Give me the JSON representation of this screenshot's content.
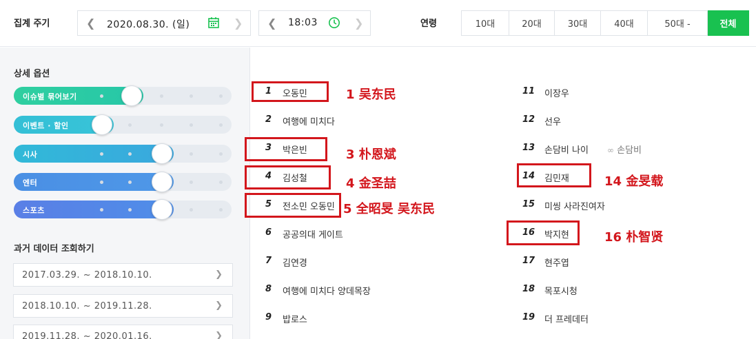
{
  "top": {
    "aggregation_label": "집계 주기",
    "date_value": "2020.08.30. (일)",
    "time_value": "18:03",
    "age_label": "연령",
    "age_options": [
      "10대",
      "20대",
      "30대",
      "40대",
      "50대 -",
      "전체"
    ],
    "age_selected": "전체"
  },
  "left": {
    "options_title": "상세 옵션",
    "toggles": [
      {
        "label": "이슈별 묶어보기",
        "on": true
      },
      {
        "label": "이벤트 · 할인",
        "on": false
      },
      {
        "label": "시사",
        "on": true
      },
      {
        "label": "엔터",
        "on": true
      },
      {
        "label": "스포츠",
        "on": true
      }
    ],
    "past_title": "과거 데이터 조회하기",
    "periods": [
      "2017.03.29. ~ 2018.10.10.",
      "2018.10.10. ~ 2019.11.28.",
      "2019.11.28. ~ 2020.01.16."
    ]
  },
  "ranking": {
    "left_col": [
      {
        "rank": "1",
        "term": "오동민"
      },
      {
        "rank": "2",
        "term": "여행에 미치다"
      },
      {
        "rank": "3",
        "term": "박은빈"
      },
      {
        "rank": "4",
        "term": "김성철"
      },
      {
        "rank": "5",
        "term": "전소민 오동민"
      },
      {
        "rank": "6",
        "term": "공공의대 게이트"
      },
      {
        "rank": "7",
        "term": "김연경"
      },
      {
        "rank": "8",
        "term": "여행에 미치다 양데목장"
      },
      {
        "rank": "9",
        "term": "밥로스"
      }
    ],
    "right_col": [
      {
        "rank": "11",
        "term": "이장우"
      },
      {
        "rank": "12",
        "term": "선우"
      },
      {
        "rank": "13",
        "term": "손담비 나이",
        "related": "손담비"
      },
      {
        "rank": "14",
        "term": "김민재"
      },
      {
        "rank": "15",
        "term": "미씽 사라진여자"
      },
      {
        "rank": "16",
        "term": "박지현"
      },
      {
        "rank": "17",
        "term": "현주엽"
      },
      {
        "rank": "18",
        "term": "목포시청"
      },
      {
        "rank": "19",
        "term": "더 프레데터"
      }
    ]
  },
  "annotations": {
    "a1": "1 吴东民",
    "a3": "3 朴恩斌",
    "a4": "4 金圣喆",
    "a5": "5 全昭旻 吴东民",
    "a14": "14 金旻载",
    "a16": "16 朴智贤"
  },
  "colors": {
    "active_green": "#19c150",
    "toggle_green": "#2fcfa0",
    "toggle_teal": "#31b9d8",
    "toggle_blue": "#4a8fe4",
    "annotation_red": "#d3161c"
  }
}
